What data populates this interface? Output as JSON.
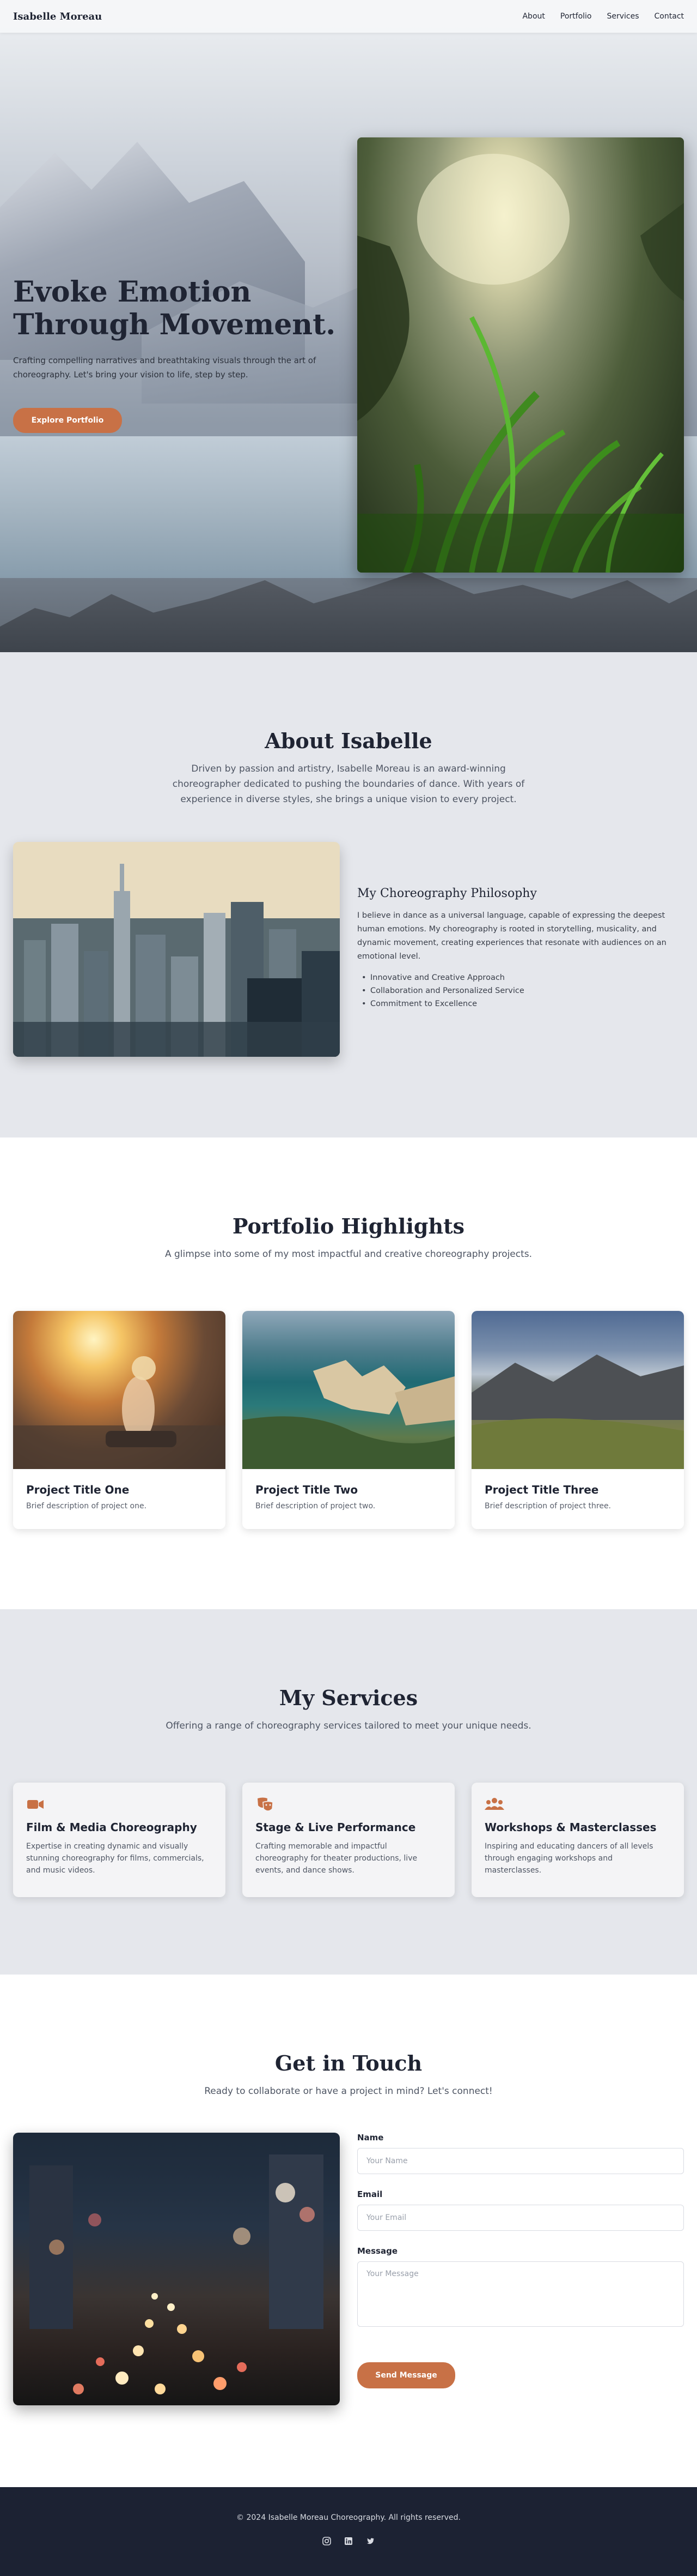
{
  "nav": {
    "brand": "Isabelle Moreau",
    "links": [
      "About",
      "Portfolio",
      "Services",
      "Contact"
    ]
  },
  "hero": {
    "title_line1": "Evoke Emotion",
    "title_line2": "Through Movement.",
    "subtitle": "Crafting compelling narratives and breathtaking visuals through the art of choreography. Let's bring your vision to life, step by step.",
    "cta": "Explore Portfolio"
  },
  "about": {
    "title": "About Isabelle",
    "intro": "Driven by passion and artistry, Isabelle Moreau is an award-winning choreographer dedicated to pushing the boundaries of dance. With years of experience in diverse styles, she brings a unique vision to every project.",
    "philosophy_title": "My Choreography Philosophy",
    "philosophy_text": "I believe in dance as a universal language, capable of expressing the deepest human emotions. My choreography is rooted in storytelling, musicality, and dynamic movement, creating experiences that resonate with audiences on an emotional level.",
    "points": [
      "Innovative and Creative Approach",
      "Collaboration and Personalized Service",
      "Commitment to Excellence"
    ]
  },
  "portfolio": {
    "title": "Portfolio Highlights",
    "subtitle": "A glimpse into some of my most impactful and creative choreography projects.",
    "projects": [
      {
        "title": "Project Title One",
        "desc": "Brief description of project one."
      },
      {
        "title": "Project Title Two",
        "desc": "Brief description of project two."
      },
      {
        "title": "Project Title Three",
        "desc": "Brief description of project three."
      }
    ]
  },
  "services": {
    "title": "My Services",
    "subtitle": "Offering a range of choreography services tailored to meet your unique needs.",
    "items": [
      {
        "title": "Film & Media Choreography",
        "desc": "Expertise in creating dynamic and visually stunning choreography for films, commercials, and music videos.",
        "icon": "video-camera-icon"
      },
      {
        "title": "Stage & Live Performance",
        "desc": "Crafting memorable and impactful choreography for theater productions, live events, and dance shows.",
        "icon": "theater-masks-icon"
      },
      {
        "title": "Workshops & Masterclasses",
        "desc": "Inspiring and educating dancers of all levels through engaging workshops and masterclasses.",
        "icon": "users-icon"
      }
    ],
    "accent": "#c87146"
  },
  "contact": {
    "title": "Get in Touch",
    "subtitle": "Ready to collaborate or have a project in mind? Let's connect!",
    "name_label": "Name",
    "name_placeholder": "Your Name",
    "email_label": "Email",
    "email_placeholder": "Your Email",
    "message_label": "Message",
    "message_placeholder": "Your Message",
    "send": "Send Message"
  },
  "footer": {
    "copyright": "© 2024 Isabelle Moreau Choreography. All rights reserved.",
    "socials": [
      "instagram-icon",
      "linkedin-icon",
      "twitter-icon"
    ]
  }
}
